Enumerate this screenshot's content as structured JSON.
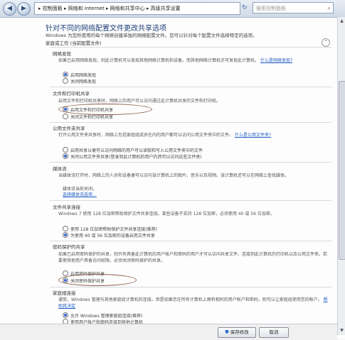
{
  "address": {
    "back": "◀",
    "forward": "▶",
    "crumbs": "▸ 控制面板 ▸ 网络和 Internet ▸ 网络和共享中心 ▸ 高级共享设置",
    "search_placeholder": "搜索控制面板",
    "refresh": "↻"
  },
  "page": {
    "title": "针对不同的网络配置文件更改共享选项",
    "description": "Windows 为您所使用的每个网络创建单独的网络配置文件。您可以针对每个配置文件选择特定的选项。",
    "profile_header": "家庭或工作 (当前配置文件)",
    "collapse": "⌃"
  },
  "sections": {
    "discovery": {
      "title": "网络发现",
      "desc": "如果已启用网络发现，则此计算机可以发现其他网络计算机和设备，而其他网络计算机亦可发现此计算机。",
      "link": "什么是网络发现?",
      "opt_on": "启用网络发现",
      "opt_off": "关闭网络发现"
    },
    "file_print": {
      "title": "文件和打印机共享",
      "desc": "启用文件和打印机共享时，网络上的用户可以访问通过此计算机共享的文件和打印机。",
      "opt_on": "启用文件和打印机共享",
      "opt_off": "关闭文件和打印机共享"
    },
    "public_folder": {
      "title": "公用文件夹共享",
      "desc": "打开公用文件夹共享时，网络上包括家庭组成员在内的用户都可以访问公用文件夹中的文件。",
      "link": "什么是公用文件夹?",
      "opt_on": "启用共享以便可以访问网络的用户可以读取和写入公用文件夹中的文件",
      "opt_off": "关闭公用文件夹共享(登录到此计算机的用户仍然可以访问这些文件夹)"
    },
    "media": {
      "title": "媒体流",
      "desc": "当媒体流打开时，网络上的人员和设备便可以访问该计算机上的图片、音乐以及视频。该计算机还可以在网络上查找媒体。",
      "status": "媒体流当前关闭。",
      "link": "选择媒体流选项..."
    },
    "conn": {
      "title": "文件共享连接",
      "desc": "Windows 7 使用 128 位加密帮助保护文件共享连接。某些设备不支持 128 位加密，必须使用 40 或 56 位加密。",
      "opt_128": "使用 128 位加密帮助保护文件共享连接(推荐)",
      "opt_40": "为使用 40 或 56 位加密的设备启用文件共享"
    },
    "password": {
      "title": "密码保护的共享",
      "desc": "如果已启用密码保护的共享，则只有具备此计算机的用户帐户和密码的用户才可以访问共享文件、连接到此计算机的打印机以及公用文件夹。若要使其他用户具备访问权限，必须关闭密码保护的共享。",
      "opt_on": "启用密码保护共享",
      "opt_off": "关闭密码保护共享"
    },
    "homegroup": {
      "title": "家庭组连接",
      "desc": "通常，Windows 管理与其他家庭组计算机的连接。但是如果您在所有计算机上拥有相同的用户帐户和密码，则可以让家庭组使用您的帐户。",
      "link": "帮助我决定",
      "opt_on": "允许 Windows 管理家庭组连接(推荐)",
      "opt_off": "使用用户帐户和密码连接到其他计算机"
    }
  },
  "footer": {
    "save": "保存修改",
    "cancel": "取消"
  },
  "colors": {
    "link": "#1f5cc4",
    "title": "#1e3f77"
  }
}
